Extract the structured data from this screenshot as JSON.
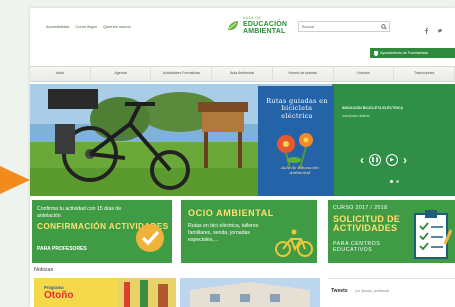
{
  "top_links": [
    "Accesibilidad",
    "Como llegar",
    "Quiénes somos"
  ],
  "logo": {
    "line1": "AULA DE",
    "line2": "EDUCACIÓN",
    "line3": "AMBIENTAL"
  },
  "search": {
    "placeholder": "Buscar"
  },
  "ayuntamiento": "Ayuntamiento de Fuenlabrada",
  "nav": [
    "Inicio",
    "Agenda",
    "Actividades Formativas",
    "Aula Ambiental",
    "Huerto de plantas",
    "Huertos",
    "Transiciones"
  ],
  "hero": {
    "side_title": "INICIACIÓN BICICLETA ELÉCTRICA",
    "side_sub": "Inscripción abierta",
    "book_title": "Rutas guiadas en bicicleta eléctrica",
    "book_footer": "Aula de Educación Ambiental",
    "slides": 2,
    "active_slide": 1
  },
  "promo1": {
    "line1": "Confirma tu actividad con 15 días de antelación",
    "heading": "CONFIRMACIÓN ACTIVIDADES",
    "footer": "PARA PROFESORES"
  },
  "promo2": {
    "heading": "OCIO AMBIENTAL",
    "body": "Rutas en bici eléctrica, talleres familiares, senda, jornadas especiales,..."
  },
  "promo3": {
    "course": "CURSO 2017 / 2018",
    "heading": "SOLICITUD DE ACTIVIDADES",
    "footer": "PARA CENTROS EDUCATIVOS"
  },
  "news": {
    "heading": "Noticias",
    "thumb1_line1": "Programa",
    "thumb1_line2": "Otoño"
  },
  "tweets": {
    "title": "Tweets",
    "by": "por @aula_ambiental"
  },
  "colors": {
    "green": "#3f9c45",
    "accent": "#f28a1c",
    "yellow": "#ffe070"
  }
}
